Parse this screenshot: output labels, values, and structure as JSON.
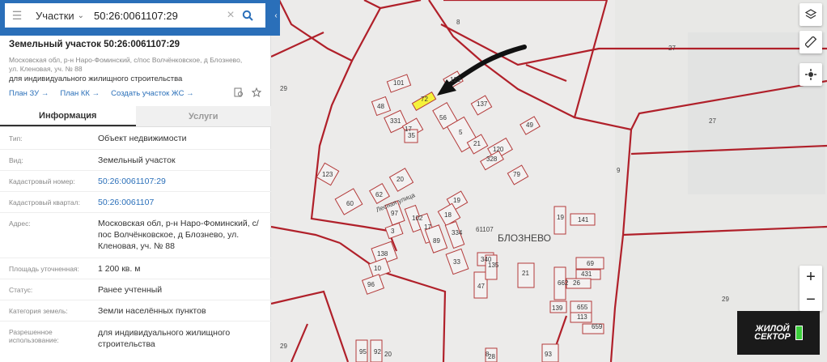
{
  "search": {
    "layer": "Участки",
    "query": "50:26:0061107:29"
  },
  "parcel": {
    "title": "Земельный участок 50:26:0061107:29",
    "address": "Московская обл, р-н Наро-Фоминский, с/пос Волчёнковское, д Блознево, ул. Кленовая, уч. № 88",
    "purpose": "для индивидуального жилищного строительства"
  },
  "links": [
    "План ЗУ →",
    "План КК →",
    "Создать участок ЖС →"
  ],
  "tabs": [
    "Информация",
    "Услуги"
  ],
  "info": [
    {
      "key": "Тип:",
      "value": "Объект недвижимости"
    },
    {
      "key": "Вид:",
      "value": "Земельный участок"
    },
    {
      "key": "Кадастровый номер:",
      "value": "50:26:0061107:29"
    },
    {
      "key": "Кадастровый квартал:",
      "value": "50:26:0061107"
    },
    {
      "key": "Адрес:",
      "value": "Московская обл, р-н Наро-Фоминский, с/пос Волчёнковское, д Блознево, ул. Кленовая, уч. № 88"
    },
    {
      "key": "Площадь уточненная:",
      "value": "1 200 кв. м"
    },
    {
      "key": "Статус:",
      "value": "Ранее учтенный"
    },
    {
      "key": "Категория земель:",
      "value": "Земли населённых пунктов"
    },
    {
      "key": "Разрешенное использование:",
      "value": "для индивидуального жилищного строительства"
    }
  ],
  "map": {
    "village": "БЛОЗНЕВО",
    "street": "Лесная улица",
    "quarter": "61107",
    "area_labels": [
      "8",
      "27",
      "29",
      "27",
      "29",
      "29",
      "9",
      "8"
    ],
    "lot_labels": [
      "101",
      "72",
      "48",
      "122",
      "56",
      "331",
      "17",
      "35",
      "5",
      "137",
      "49",
      "21",
      "120",
      "328",
      "79",
      "123",
      "62",
      "20",
      "60",
      "19",
      "97",
      "102",
      "17",
      "18",
      "19",
      "141",
      "3",
      "89",
      "334",
      "138",
      "33",
      "340",
      "10",
      "96",
      "47",
      "135",
      "21",
      "69",
      "431",
      "26",
      "662",
      "139",
      "655",
      "113",
      "659",
      "95",
      "92",
      "93",
      "28",
      "20"
    ]
  },
  "brand": {
    "line1": "ЖИЛОЙ",
    "line2": "СЕКТОР"
  },
  "colors": {
    "header": "#2a6fb9",
    "link": "#2a6fb9",
    "boundary": "#b0202a",
    "selected": "#f5f23a"
  }
}
